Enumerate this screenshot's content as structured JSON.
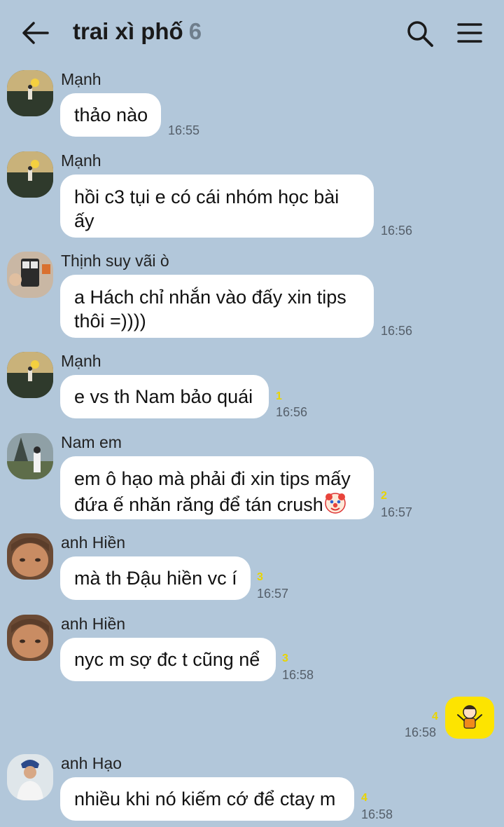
{
  "header": {
    "title": "trai xì phố",
    "member_count": "6"
  },
  "messages": [
    {
      "sender": "Mạnh",
      "text": "thảo nào",
      "time": "16:55",
      "unread": ""
    },
    {
      "sender": "Mạnh",
      "text": "hồi c3 tụi e có cái nhóm học bài ấy",
      "time": "16:56",
      "unread": ""
    },
    {
      "sender": "Thịnh suy vãi ò",
      "text": "a Hách chỉ nhắn vào đấy xin tips thôi =))))",
      "time": "16:56",
      "unread": ""
    },
    {
      "sender": "Mạnh",
      "text": "e vs th Nam bảo quái",
      "time": "16:56",
      "unread": "1"
    },
    {
      "sender": "Nam em",
      "text": "em ô hạo mà phải đi xin tips mấy đứa ế nhăn răng để tán crush",
      "time": "16:57",
      "unread": "2"
    },
    {
      "sender": "anh Hiền",
      "text": "mà th Đậu hiền vc í",
      "time": "16:57",
      "unread": "3"
    },
    {
      "sender": "anh Hiền",
      "text": "nyc m sợ đc t cũng nể",
      "time": "16:58",
      "unread": "3"
    },
    {
      "sender": "anh Hạo",
      "text": "nhiều khi nó kiếm cớ để ctay m",
      "time": "16:58",
      "unread": "4"
    }
  ],
  "my_message": {
    "time": "16:58",
    "unread": "4",
    "sticker": "shrug-person-icon"
  },
  "colors": {
    "background": "#b2c7da",
    "bubble": "#ffffff",
    "my_bubble": "#fde400",
    "unread": "#e9d400"
  }
}
